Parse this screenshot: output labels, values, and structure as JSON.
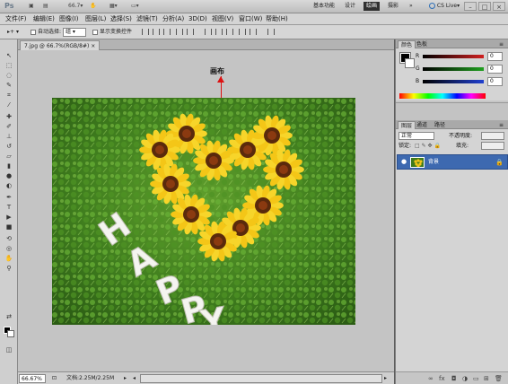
{
  "app": {
    "logo": "Ps",
    "workspaces": [
      "基本功能",
      "设计",
      "绘画",
      "摄影"
    ],
    "active_workspace": "绘画",
    "more": "»",
    "cslive": "CS Live▾",
    "zoom_toolbar": "66.7",
    "window_buttons": [
      "–",
      "□",
      "×"
    ]
  },
  "menu": [
    "文件(F)",
    "编辑(E)",
    "图像(I)",
    "图层(L)",
    "选择(S)",
    "滤镜(T)",
    "分析(A)",
    "3D(D)",
    "视图(V)",
    "窗口(W)",
    "帮助(H)"
  ],
  "options": {
    "auto_select_label": "自动选择:",
    "auto_select_value": "组",
    "show_transform_label": "显示变换控件"
  },
  "document": {
    "tab_title": "7.jpg @ 66.7%(RGB/8#)",
    "canvas_annotation": "画布",
    "zoom": "66.67%",
    "doc_info": "文档:2.25M/2.25M",
    "photo_text": "HAPPY"
  },
  "color_panel": {
    "tabs": [
      "颜色",
      "色板"
    ],
    "channels": [
      {
        "label": "R",
        "value": "0",
        "color": "#d02020"
      },
      {
        "label": "G",
        "value": "0",
        "color": "#20a020"
      },
      {
        "label": "B",
        "value": "0",
        "color": "#2040d0"
      }
    ]
  },
  "layers_panel": {
    "tabs": [
      "图层",
      "通道",
      "路径"
    ],
    "blend_mode": "正常",
    "opacity_label": "不透明度:",
    "lock_label": "锁定:",
    "fill_label": "填充:",
    "layer_name": "背景"
  },
  "colors": {
    "selected_layer": "#3d69b0",
    "arrow": "#dd1111"
  }
}
